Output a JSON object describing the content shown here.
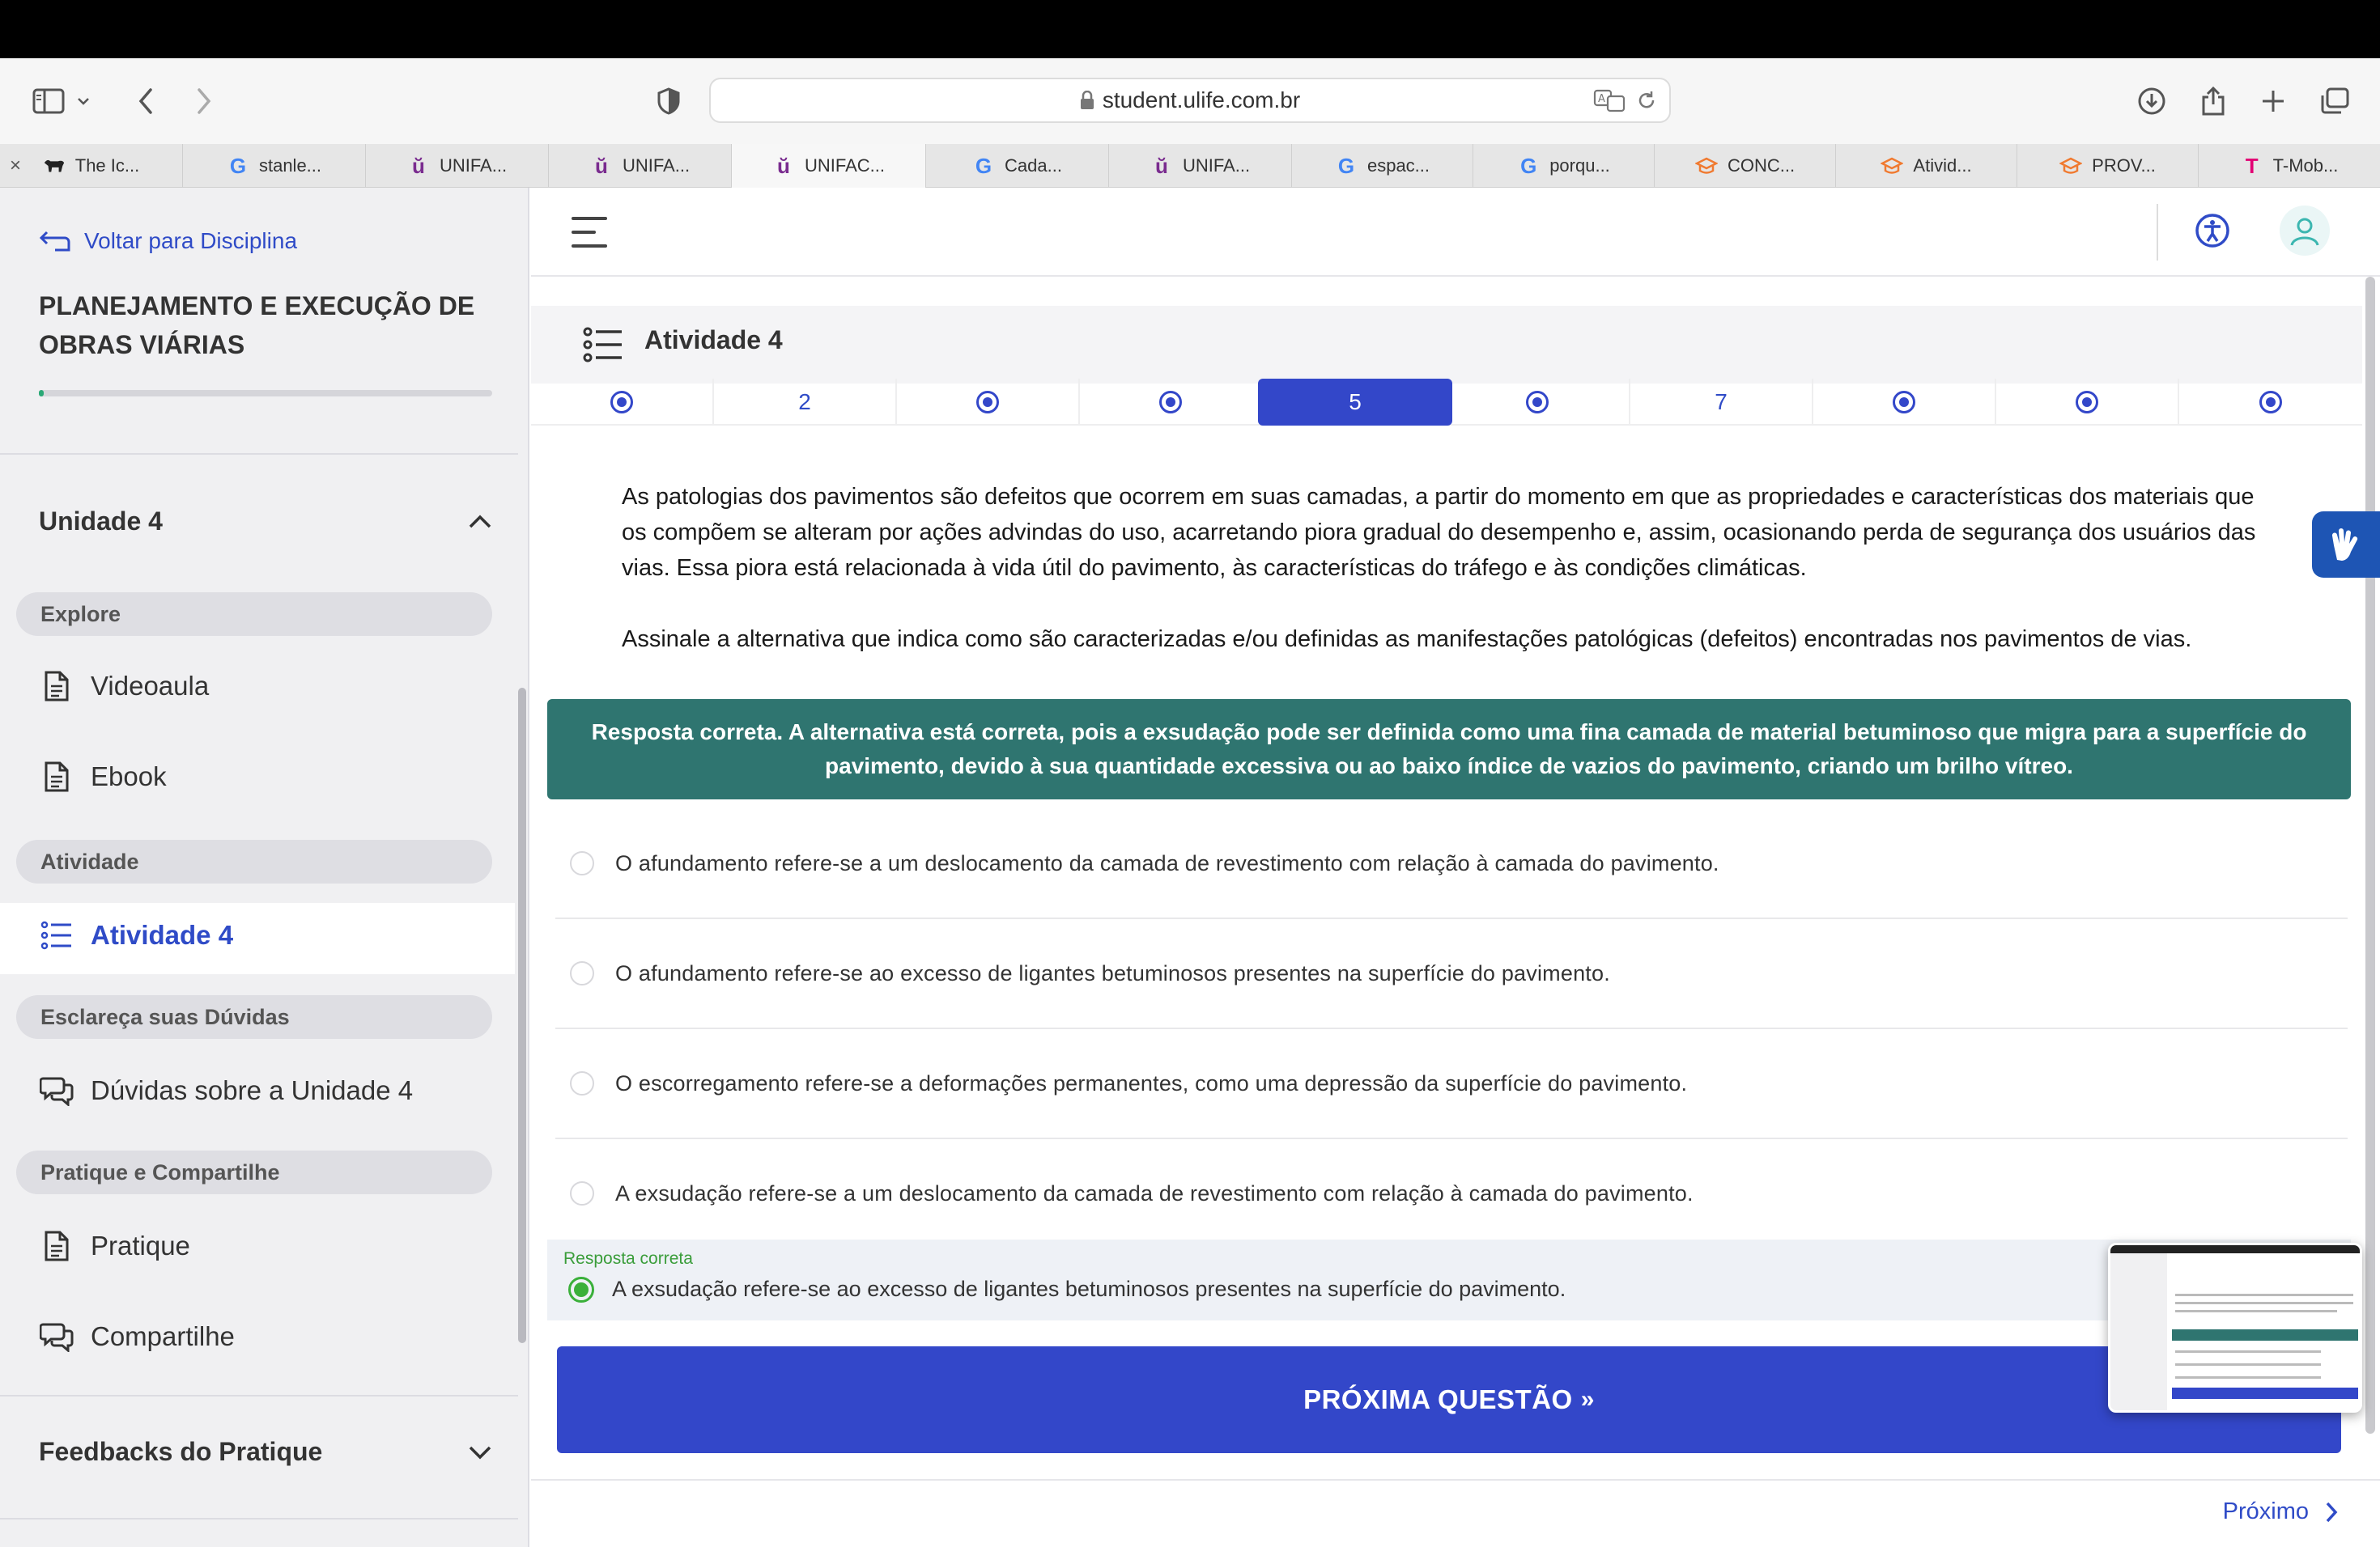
{
  "browser": {
    "url": "student.ulife.com.br",
    "tabs": [
      {
        "label": "The Ic...",
        "icon": "bull-favicon",
        "closable": true
      },
      {
        "label": "stanle...",
        "icon": "google-icon"
      },
      {
        "label": "UNIFA...",
        "icon": "ulife-icon"
      },
      {
        "label": "UNIFA...",
        "icon": "ulife-icon"
      },
      {
        "label": "UNIFAC...",
        "icon": "ulife-icon",
        "active": true
      },
      {
        "label": "Cada...",
        "icon": "google-icon"
      },
      {
        "label": "UNIFA...",
        "icon": "ulife-icon"
      },
      {
        "label": "espac...",
        "icon": "google-icon"
      },
      {
        "label": "porqu...",
        "icon": "google-icon"
      },
      {
        "label": "CONC...",
        "icon": "graduation-cap-icon"
      },
      {
        "label": "Ativid...",
        "icon": "graduation-cap-icon"
      },
      {
        "label": "PROV...",
        "icon": "graduation-cap-icon"
      },
      {
        "label": "T-Mob...",
        "icon": "tmobile-icon"
      }
    ]
  },
  "sidebar": {
    "back_label": "Voltar para Disciplina",
    "course_title": "PLANEJAMENTO E EXECUÇÃO DE OBRAS VIÁRIAS",
    "progress_fraction": 0.01,
    "unit_label": "Unidade 4",
    "sections": {
      "explore": "Explore",
      "atividade": "Atividade",
      "duvidas": "Esclareça suas Dúvidas",
      "pratique": "Pratique e Compartilhe"
    },
    "items": {
      "videoaula": "Videoaula",
      "ebook": "Ebook",
      "atividade4": "Atividade 4",
      "duvidas_unidade": "Dúvidas sobre a Unidade 4",
      "pratique": "Pratique",
      "compartilhe": "Compartilhe"
    },
    "feedback_label": "Feedbacks do Pratique"
  },
  "activity": {
    "title": "Atividade 4",
    "nav": [
      {
        "type": "answered"
      },
      {
        "type": "number",
        "label": "2"
      },
      {
        "type": "answered"
      },
      {
        "type": "answered"
      },
      {
        "type": "current",
        "label": "5"
      },
      {
        "type": "answered"
      },
      {
        "type": "number",
        "label": "7"
      },
      {
        "type": "answered"
      },
      {
        "type": "answered"
      },
      {
        "type": "answered"
      }
    ]
  },
  "question": {
    "paragraph1": "As patologias dos pavimentos são defeitos que ocorrem em suas camadas, a partir do momento em que as propriedades e características dos materiais que os compõem se alteram por ações advindas do uso, acarretando piora gradual do desempenho e, assim, ocasionando perda de segurança dos usuários das vias. Essa piora está relacionada à vida útil do pavimento, às características do tráfego e às condições climáticas.",
    "paragraph2": "Assinale a alternativa que indica como são caracterizadas e/ou definidas as manifestações patológicas (defeitos) encontradas nos pavimentos de vias.",
    "feedback": "Resposta correta. A alternativa está correta, pois a exsudação pode ser definida como uma fina camada de material betuminoso que migra para a superfície do pavimento, devido à sua quantidade excessiva ou ao baixo índice de vazios do pavimento, criando um brilho vítreo.",
    "options": [
      "O afundamento refere-se a um deslocamento da camada de revestimento com relação à camada do pavimento.",
      "O afundamento refere-se ao excesso de ligantes betuminosos presentes na superfície do pavimento.",
      "O escorregamento refere-se a deformações permanentes, como uma depressão da superfície do pavimento.",
      "A exsudação refere-se a um deslocamento da camada de revestimento com relação à camada do pavimento."
    ],
    "correct_label": "Resposta correta",
    "correct_option": "A exsudação refere-se ao excesso de ligantes betuminosos presentes na superfície do pavimento."
  },
  "buttons": {
    "next_question": "PRÓXIMA QUESTÃO",
    "next_question_arrow": "»",
    "proximo": "Próximo"
  },
  "colors": {
    "accent": "#3347c9",
    "feedback_bg": "#2f7570",
    "correct_green": "#3ab03a",
    "link_blue": "#2f4bc7"
  }
}
